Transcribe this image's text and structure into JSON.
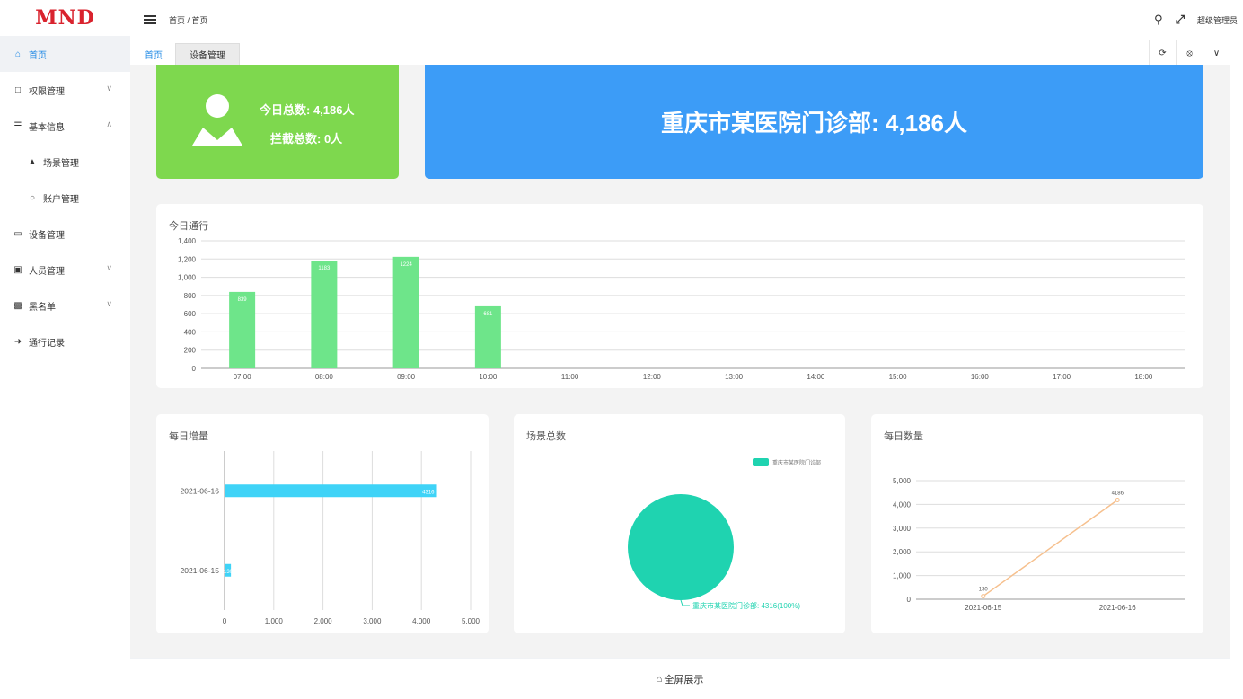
{
  "logo": {
    "text": "MND"
  },
  "sidebar": {
    "items": [
      {
        "label": "首页",
        "icon": "home-icon"
      },
      {
        "label": "权限管理",
        "icon": "folder-icon"
      },
      {
        "label": "基本信息",
        "icon": "database-icon"
      },
      {
        "label": "场景管理",
        "icon": "scene-icon"
      },
      {
        "label": "账户管理",
        "icon": "circle-icon"
      },
      {
        "label": "设备管理",
        "icon": "monitor-icon"
      },
      {
        "label": "人员管理",
        "icon": "id-card-icon"
      },
      {
        "label": "黑名单",
        "icon": "blacklist-card-icon"
      },
      {
        "label": "通行记录",
        "icon": "sign-out-icon"
      }
    ]
  },
  "header": {
    "breadcrumb": "首页 / 首页",
    "user": "超级管理员"
  },
  "tabs": [
    {
      "label": "首页"
    },
    {
      "label": "设备管理"
    }
  ],
  "stats": {
    "today_total": "今日总数: 4,186人",
    "blocked_total": "拦截总数: 0人",
    "banner": "重庆市某医院门诊部: 4,186人"
  },
  "hourly": {
    "title": "今日通行",
    "chart_data": {
      "type": "bar",
      "categories": [
        "07:00",
        "08:00",
        "09:00",
        "10:00",
        "11:00",
        "12:00",
        "13:00",
        "14:00",
        "15:00",
        "16:00",
        "17:00",
        "18:00"
      ],
      "values": [
        839,
        1183,
        1224,
        681,
        0,
        0,
        0,
        0,
        0,
        0,
        0,
        0
      ],
      "data_labels": [
        "839",
        "1183",
        "1224",
        "681"
      ],
      "yticks": [
        "0",
        "200",
        "400",
        "600",
        "800",
        "1,000",
        "1,200",
        "1,400"
      ],
      "ylim": [
        0,
        1400
      ],
      "color": "#6ee58a"
    }
  },
  "daily_increase": {
    "title": "每日增量",
    "chart_data": {
      "type": "bar",
      "orientation": "horizontal",
      "categories": [
        "2021-06-16",
        "2021-06-15"
      ],
      "values": [
        4316,
        130
      ],
      "data_labels": [
        "4316",
        "130"
      ],
      "xticks": [
        "0",
        "1,000",
        "2,000",
        "3,000",
        "4,000",
        "5,000"
      ],
      "xlim": [
        0,
        5000
      ],
      "color": "#3fd3f7"
    }
  },
  "scenes": {
    "title": "场景总数",
    "chart_data": {
      "type": "pie",
      "labels": [
        "重庆市某医院门诊部"
      ],
      "values": [
        4316
      ],
      "slice_label": "重庆市某医院门诊部: 4316(100%)",
      "legend": "top-right",
      "color": "#1fd3b0"
    }
  },
  "daily_count": {
    "title": "每日数量",
    "chart_data": {
      "type": "line",
      "x": [
        "2021-06-15",
        "2021-06-16"
      ],
      "values": [
        130,
        4186
      ],
      "data_labels": [
        "130",
        "4186"
      ],
      "yticks": [
        "0",
        "1,000",
        "2,000",
        "3,000",
        "4,000",
        "5,000"
      ],
      "ylim": [
        0,
        5000
      ],
      "color": "#f6c08e"
    }
  },
  "footer": {
    "label": "全屏展示"
  }
}
